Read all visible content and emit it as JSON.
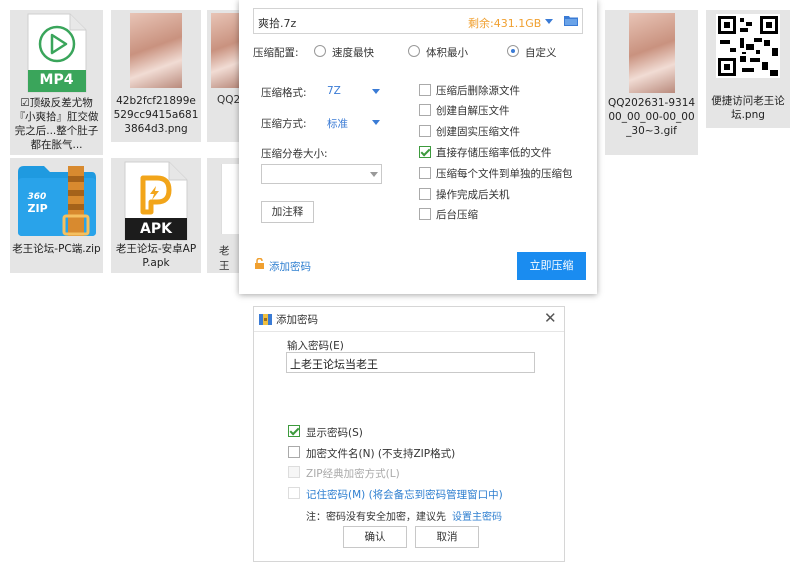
{
  "files": [
    {
      "name": "☑顶级反差尤物『小爽拾』肛交做完之后...整个肚子都在胀气...",
      "icon": "mp4-icon",
      "type_label": "MP4"
    },
    {
      "name": "42b2fcf21899e529cc9415a6813864d3.png"
    },
    {
      "name": "QQ2..."
    },
    {
      "name": "QQ2026319314 00_00_00-00_00_30~3.gif",
      "display": "QQ202631-931400_00_00-00_00_30~3.gif"
    },
    {
      "name": "便捷访问老王论坛.png"
    },
    {
      "name": "老王论坛-PC端.zip",
      "icon": "zip-icon",
      "type_label": "ZIP"
    },
    {
      "name": "老王论坛-安卓APP.apk",
      "icon": "apk-icon",
      "type_label": "APK"
    },
    {
      "name": "老王..."
    }
  ],
  "captions": {
    "f1": "☑顶级反差尤物『小爽拾』肛交做完之后...整个肚子都在胀气...",
    "f2": "42b2fcf21899e529cc9415a6813864d3.png",
    "f3": "QQ2",
    "f4": "QQ202631-931400_00_00-00_00_30~3.gif",
    "f5": "便捷访问老王论坛.png",
    "f6": "老王论坛-PC端.zip",
    "f7": "老王论坛-安卓APP.apk",
    "f8": "老王"
  },
  "compress": {
    "filename": "爽拾.7z",
    "space": "剩余:431.1GB",
    "config_label": "压缩配置:",
    "modes": [
      "速度最快",
      "体积最小",
      "自定义"
    ],
    "selected_mode": "自定义",
    "format_label": "压缩格式:",
    "format_value": "7Z",
    "method_label": "压缩方式:",
    "method_value": "标准",
    "split_label": "压缩分卷大小:",
    "split_value": "",
    "comment_button": "加注释",
    "options": [
      {
        "label": "压缩后删除源文件",
        "checked": false
      },
      {
        "label": "创建自解压文件",
        "checked": false
      },
      {
        "label": "创建固实压缩文件",
        "checked": false
      },
      {
        "label": "直接存储压缩率低的文件",
        "checked": true
      },
      {
        "label": "压缩每个文件到单独的压缩包",
        "checked": false
      },
      {
        "label": "操作完成后关机",
        "checked": false
      },
      {
        "label": "后台压缩",
        "checked": false
      }
    ],
    "add_password": "添加密码",
    "start_button": "立即压缩"
  },
  "password_dialog": {
    "title": "添加密码",
    "input_label": "输入密码(E)",
    "password_value": "上老王论坛当老王",
    "options": [
      {
        "label": "显示密码(S)",
        "checked": true,
        "enabled": true
      },
      {
        "label": "加密文件名(N) (不支持ZIP格式)",
        "checked": false,
        "enabled": true
      },
      {
        "label": "ZIP经典加密方式(L)",
        "checked": false,
        "enabled": false
      },
      {
        "label": "记住密码(M) (将会备忘到密码管理窗口中)",
        "checked": false,
        "enabled": true
      }
    ],
    "note": "注：密码没有安全加密，建议先",
    "note_link": "设置主密码",
    "ok_button": "确认",
    "cancel_button": "取消"
  },
  "colors": {
    "accent": "#3a7bd5",
    "space": "#f0a030",
    "start_btn": "#1a8cf0",
    "link": "#2f7fd0"
  }
}
